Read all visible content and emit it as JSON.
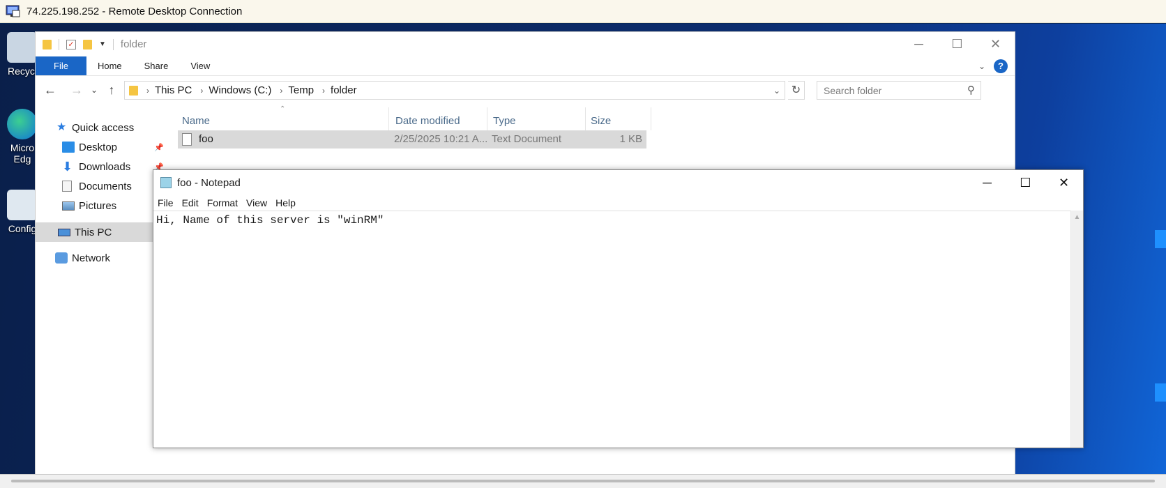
{
  "rdp": {
    "title": "74.225.198.252 - Remote Desktop Connection"
  },
  "desktop": {
    "icons": [
      {
        "label": "Recycl",
        "icon": "recycle-bin-icon"
      },
      {
        "label": "Micro Edg",
        "icon": "edge-icon"
      },
      {
        "label": "Config",
        "icon": "config-icon"
      }
    ],
    "wallpaper_accent": "#1e90ff"
  },
  "explorer": {
    "title": "folder",
    "ribbon_tabs": [
      "File",
      "Home",
      "Share",
      "View"
    ],
    "help_label": "?",
    "breadcrumb": [
      "This PC",
      "Windows (C:)",
      "Temp",
      "folder"
    ],
    "search_placeholder": "Search folder",
    "nav": {
      "quick_access": "Quick access",
      "desktop": "Desktop",
      "downloads": "Downloads",
      "documents": "Documents",
      "pictures": "Pictures",
      "this_pc": "This PC",
      "network": "Network"
    },
    "columns": [
      "Name",
      "Date modified",
      "Type",
      "Size"
    ],
    "files": [
      {
        "name": "foo",
        "date_modified": "2/25/2025 10:21 A...",
        "type": "Text Document",
        "size": "1 KB"
      }
    ],
    "accent_color": "#1a66c6"
  },
  "notepad": {
    "title": "foo - Notepad",
    "menu": [
      "File",
      "Edit",
      "Format",
      "View",
      "Help"
    ],
    "content": "Hi, Name of this server is \"winRM\""
  }
}
